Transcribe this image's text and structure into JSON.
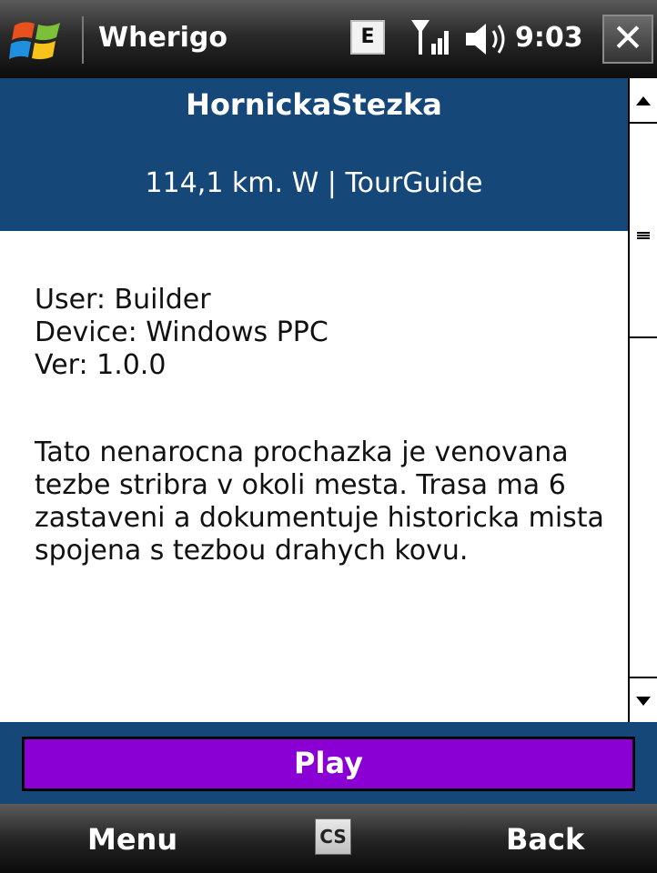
{
  "titlebar": {
    "app_title": "Wherigo",
    "edge_label": "E",
    "clock": "9:03",
    "close_label": "✕",
    "icons": [
      "windows-start-icon",
      "edge-network-icon",
      "signal-icon",
      "speaker-icon",
      "close-icon"
    ]
  },
  "header": {
    "cartridge_name": "HornickaStezka",
    "distance_info": "114,1 km. W | TourGuide"
  },
  "details": {
    "user": "User: Builder",
    "device": "Device: Windows PPC",
    "version": "Ver: 1.0.0"
  },
  "description": "Tato nenarocna prochazka je venovana tezbe stribra v okoli mesta. Trasa ma 6 zastaveni a dokumentuje historicka mista spojena s tezbou drahych kovu.",
  "play_button": "Play",
  "softkeys": {
    "left": "Menu",
    "center": "CS",
    "right": "Back"
  },
  "colors": {
    "header_bg": "#154879",
    "play_bg": "#8a00d4"
  }
}
